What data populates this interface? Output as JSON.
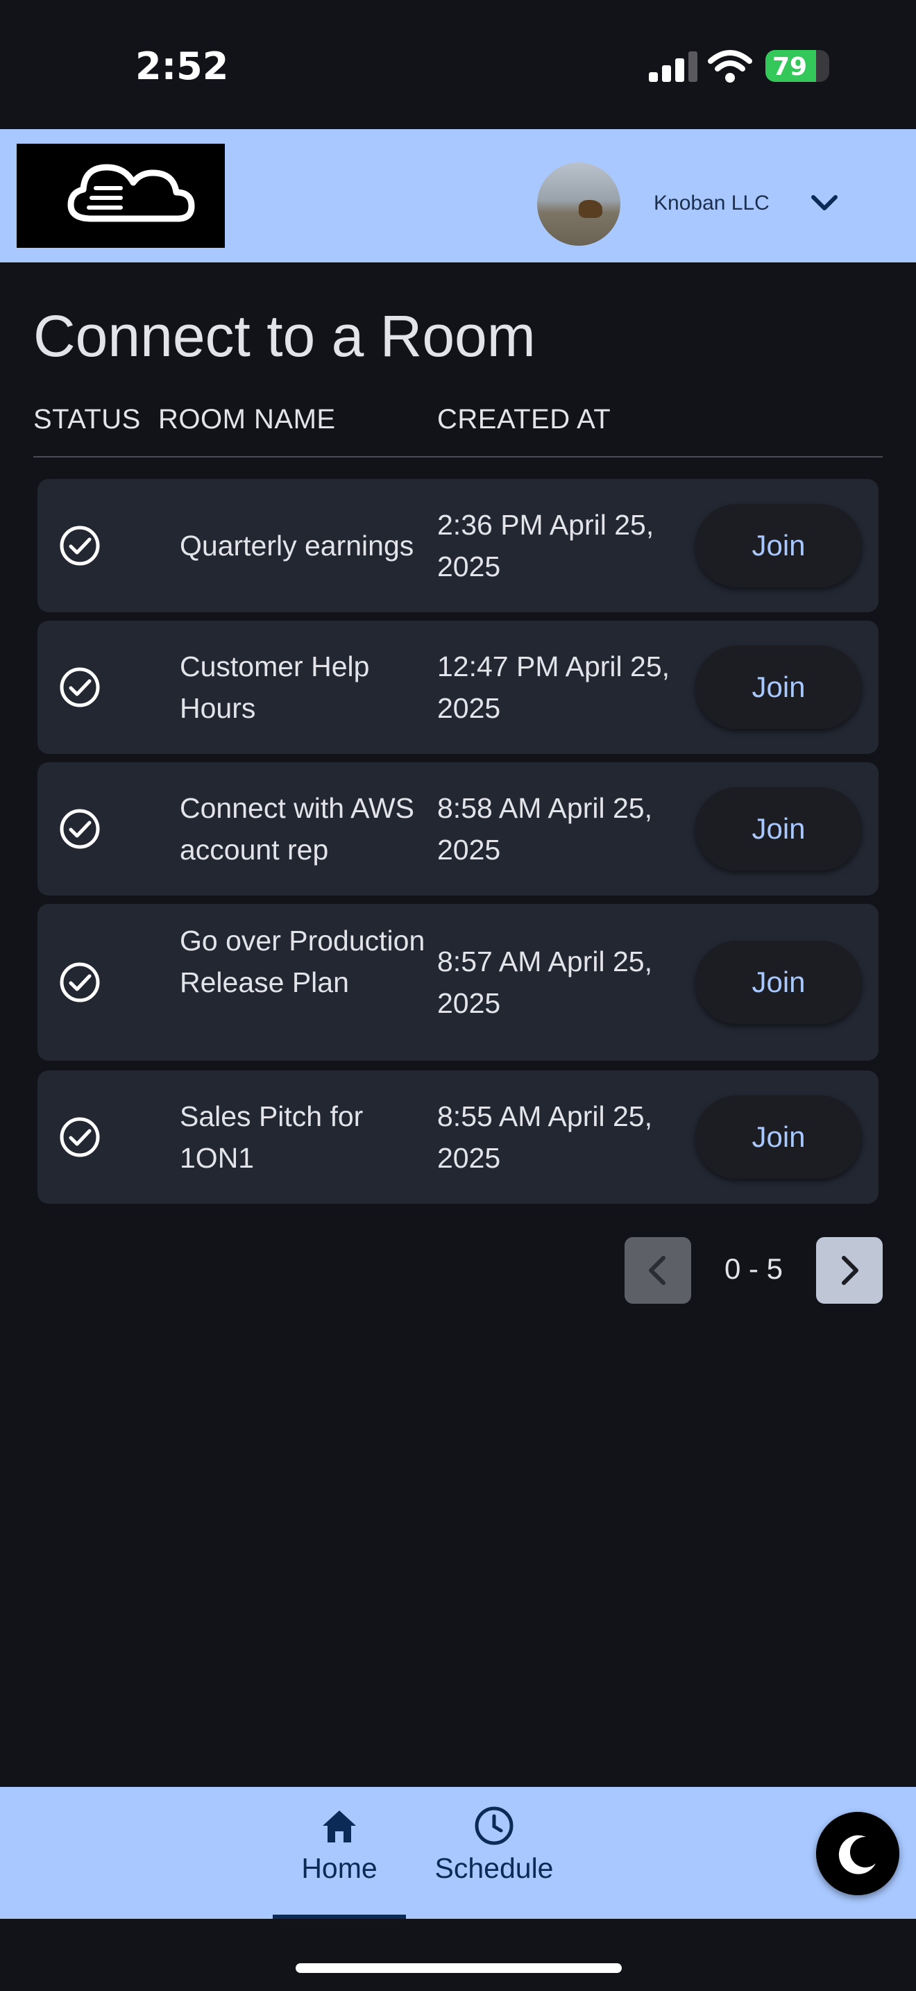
{
  "status_bar": {
    "time": "2:52",
    "battery": "79"
  },
  "header": {
    "org_name": "Knoban LLC"
  },
  "page": {
    "title": "Connect to a Room",
    "columns": [
      "STATUS",
      "ROOM NAME",
      "CREATED AT"
    ]
  },
  "rooms": [
    {
      "name": "Quarterly earnings",
      "created": "2:36 PM April 25, 2025",
      "join": "Join"
    },
    {
      "name": "Customer Help Hours",
      "created": "12:47 PM April 25, 2025",
      "join": "Join"
    },
    {
      "name": "Connect with AWS account rep",
      "created": "8:58 AM April 25, 2025",
      "join": "Join"
    },
    {
      "name": "Go over Production Release Plan",
      "created": "8:57 AM April 25, 2025",
      "join": "Join"
    },
    {
      "name": "Sales Pitch for 1ON1",
      "created": "8:55 AM April 25, 2025",
      "join": "Join"
    }
  ],
  "pagination": {
    "label": "0 - 5"
  },
  "nav": [
    {
      "label": "Home",
      "icon": "home-icon",
      "active": true
    },
    {
      "label": "Schedule",
      "icon": "clock-icon",
      "active": false
    }
  ],
  "icons": {
    "status": "check-circle-icon",
    "theme_toggle": "moon-icon",
    "logo": "cloud-icon",
    "dropdown": "chevron-down-icon"
  },
  "colors": {
    "background": "#121318",
    "surface": "#232732",
    "accent": "#a8c8ff",
    "accent_dark": "#0b2a55"
  }
}
